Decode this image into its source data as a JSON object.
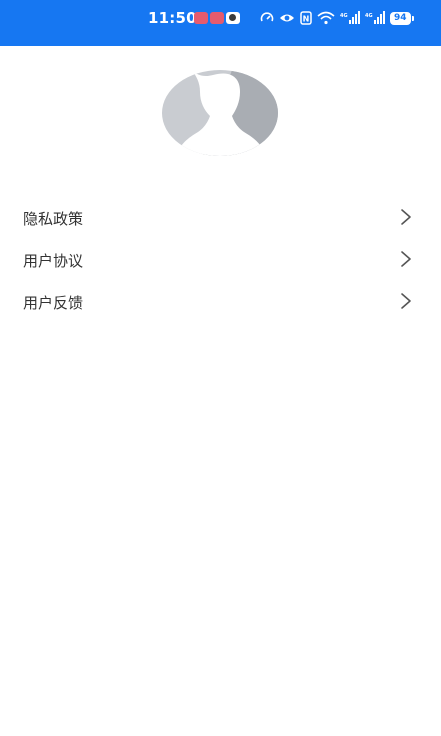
{
  "status_bar": {
    "time": "11:50",
    "battery": "94",
    "background_color": "#1677f2"
  },
  "profile": {
    "avatar_icon": "default-avatar-silhouette"
  },
  "menu": {
    "items": [
      {
        "label": "隐私政策",
        "icon": "chevron-right-icon"
      },
      {
        "label": "用户协议",
        "icon": "chevron-right-icon"
      },
      {
        "label": "用户反馈",
        "icon": "chevron-right-icon"
      }
    ]
  }
}
